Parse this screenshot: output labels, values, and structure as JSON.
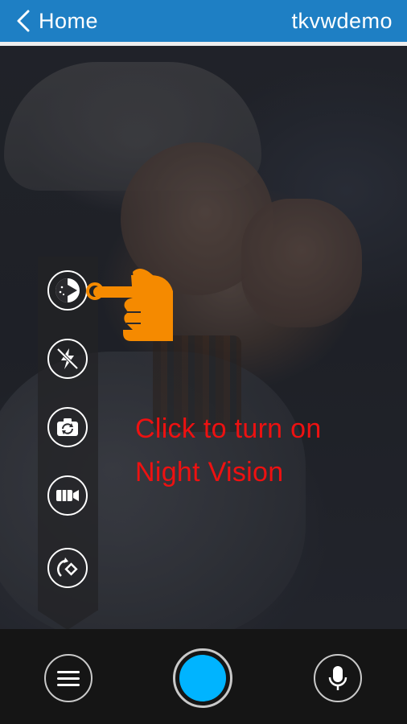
{
  "header": {
    "back_label": "Home",
    "title": "tkvwdemo"
  },
  "side_toolbar": {
    "items": [
      {
        "name": "night-vision-button",
        "icon": "night-vision-icon"
      },
      {
        "name": "flash-off-button",
        "icon": "flash-off-icon"
      },
      {
        "name": "switch-camera-button",
        "icon": "switch-camera-icon"
      },
      {
        "name": "record-video-button",
        "icon": "video-camera-icon"
      },
      {
        "name": "rotate-button",
        "icon": "rotate-icon"
      }
    ]
  },
  "instruction": {
    "line1": "Click to turn on",
    "line2": "Night Vision"
  },
  "bottom_bar": {
    "menu_icon": "menu-icon",
    "capture_icon": "capture-icon",
    "mic_icon": "microphone-icon"
  },
  "colors": {
    "header": "#1e7fc4",
    "capture": "#00b4ff",
    "pointer_hand": "#f58a00",
    "instruction_text": "#ee1111"
  }
}
